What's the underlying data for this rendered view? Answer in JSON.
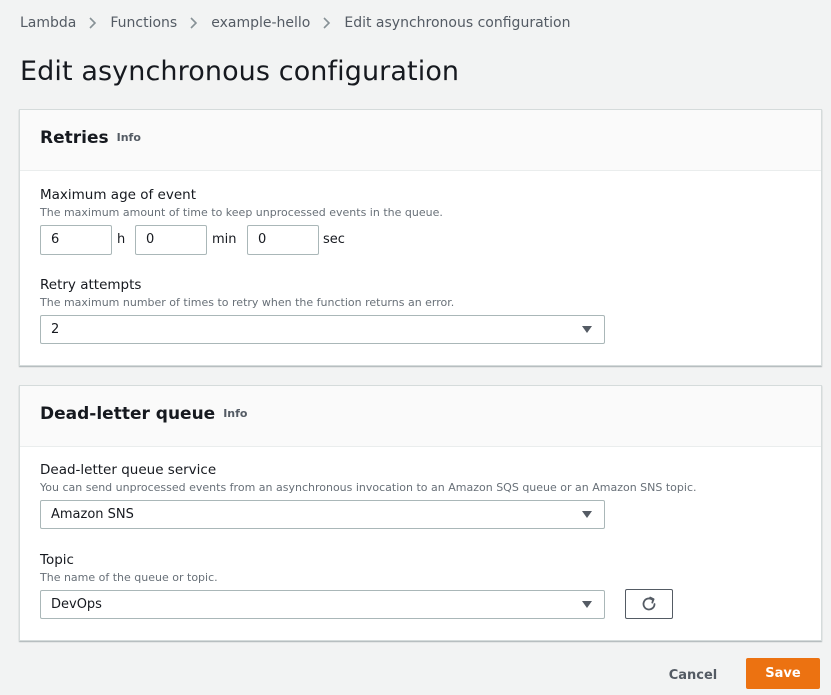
{
  "breadcrumb": [
    "Lambda",
    "Functions",
    "example-hello",
    "Edit asynchronous configuration"
  ],
  "page_title": "Edit asynchronous configuration",
  "retries": {
    "title": "Retries",
    "info": "Info",
    "max_age": {
      "label": "Maximum age of event",
      "description": "The maximum amount of time to keep unprocessed events in the queue.",
      "hours": "6",
      "hours_unit": "h",
      "minutes": "0",
      "minutes_unit": "min",
      "seconds": "0",
      "seconds_unit": "sec"
    },
    "retry_attempts": {
      "label": "Retry attempts",
      "description": "The maximum number of times to retry when the function returns an error.",
      "value": "2"
    }
  },
  "dlq": {
    "title": "Dead-letter queue",
    "info": "Info",
    "service": {
      "label": "Dead-letter queue service",
      "description": "You can send unprocessed events from an asynchronous invocation to an Amazon SQS queue or an Amazon SNS topic.",
      "value": "Amazon SNS"
    },
    "topic": {
      "label": "Topic",
      "description": "The name of the queue or topic.",
      "value": "DevOps"
    }
  },
  "footer": {
    "cancel": "Cancel",
    "save": "Save"
  },
  "colors": {
    "primary": "#ec7211",
    "background": "#f2f3f3",
    "border": "#aab7b8"
  },
  "icons": {
    "separator": "chevron-right-icon",
    "dropdown": "caret-down-icon",
    "refresh": "refresh-icon"
  }
}
